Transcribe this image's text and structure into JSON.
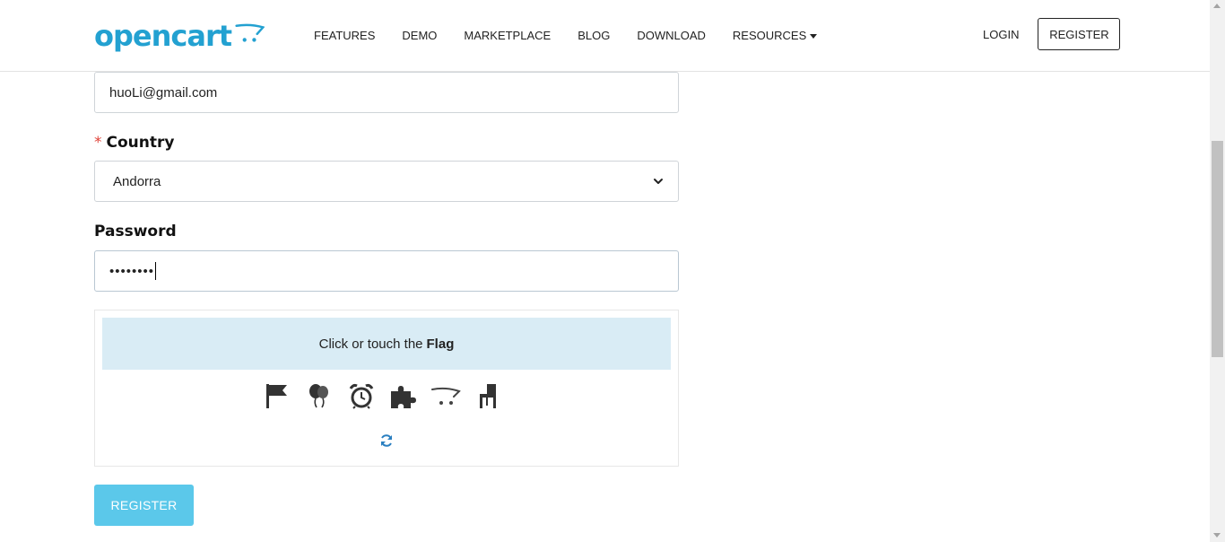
{
  "header": {
    "logo_text": "opencart",
    "nav": [
      {
        "label": "FEATURES"
      },
      {
        "label": "DEMO"
      },
      {
        "label": "MARKETPLACE"
      },
      {
        "label": "BLOG"
      },
      {
        "label": "DOWNLOAD"
      },
      {
        "label": "RESOURCES"
      }
    ],
    "login_label": "LOGIN",
    "register_label": "REGISTER"
  },
  "form": {
    "email_value": "huoLi@gmail.com",
    "country": {
      "required_mark": "*",
      "label": "Country",
      "selected": "Andorra"
    },
    "password": {
      "label": "Password",
      "masked_value": "••••••••"
    },
    "captcha": {
      "prompt": "Click or touch the",
      "target": "Flag",
      "icons": [
        "flag-icon",
        "balloons-icon",
        "alarm-clock-icon",
        "puzzle-piece-icon",
        "shopping-cart-icon",
        "chair-icon"
      ]
    },
    "submit_label": "REGISTER"
  },
  "colors": {
    "brand": "#23a1d1",
    "captcha_banner": "#d9ecf5",
    "submit_button": "#5bc8ea",
    "required": "#e0443a"
  }
}
